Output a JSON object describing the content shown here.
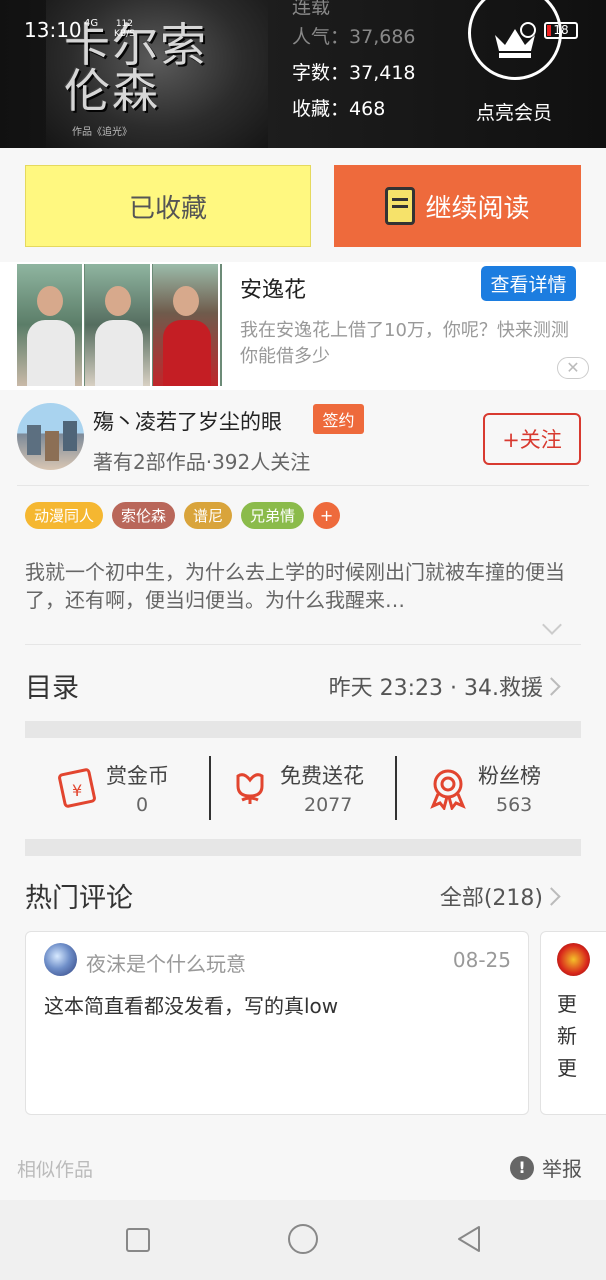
{
  "status_bar": {
    "time": "13:10",
    "network": "4G",
    "speed_value": "112",
    "speed_unit": "KB/S",
    "battery": "18"
  },
  "book": {
    "cover_title": "卡尔索伦森",
    "cover_subtitle": "作品《追光》",
    "status_faded": "连载",
    "popularity_label": "人气：",
    "popularity": "37,686",
    "word_count_label": "字数：",
    "word_count": "37,418",
    "favorites_label": "收藏：",
    "favorites": "468"
  },
  "member": {
    "label": "点亮会员"
  },
  "actions": {
    "favorited_label": "已收藏",
    "continue_label": "继续阅读"
  },
  "ad": {
    "title": "安逸花",
    "button": "查看详情",
    "description": "我在安逸花上借了10万，你呢？快来测测你能借多少",
    "close": "✕"
  },
  "author": {
    "name": "殤丶凌若了岁尘的眼",
    "badge": "签约",
    "meta": "著有2部作品·392人关注",
    "follow_label": "+关注"
  },
  "tags": [
    {
      "label": "动漫同人",
      "color": "#f5b731"
    },
    {
      "label": "索伦森",
      "color": "#b9675a"
    },
    {
      "label": "谱尼",
      "color": "#d9a43b"
    },
    {
      "label": "兄弟情",
      "color": "#8bbb4b"
    },
    {
      "label": "+",
      "color": "#ee6a3c"
    }
  ],
  "description": "我就一个初中生，为什么去上学的时候刚出门就被车撞的便当了，还有啊，便当归便当。为什么我醒来…",
  "catalog": {
    "title": "目录",
    "latest": "昨天 23:23 · 34.救援"
  },
  "stats": [
    {
      "label": "赏金币",
      "value": "0",
      "icon": "red-envelope-icon"
    },
    {
      "label": "免费送花",
      "value": "2077",
      "icon": "flower-icon"
    },
    {
      "label": "粉丝榜",
      "value": "563",
      "icon": "medal-icon"
    }
  ],
  "comments": {
    "title": "热门评论",
    "all_label": "全部(218)",
    "items": [
      {
        "user": "夜沫是个什么玩意",
        "date": "08-25",
        "text": "这本简直看都没发看，写的真low"
      },
      {
        "text": "更新更"
      }
    ]
  },
  "footer": {
    "similar": "相似作品",
    "report_label": "举报",
    "report_icon": "!"
  },
  "colors": {
    "accent": "#ee6a3c",
    "favorite_bg": "#fff880",
    "link_blue": "#1c7de0",
    "follow_red": "#d83a30"
  }
}
